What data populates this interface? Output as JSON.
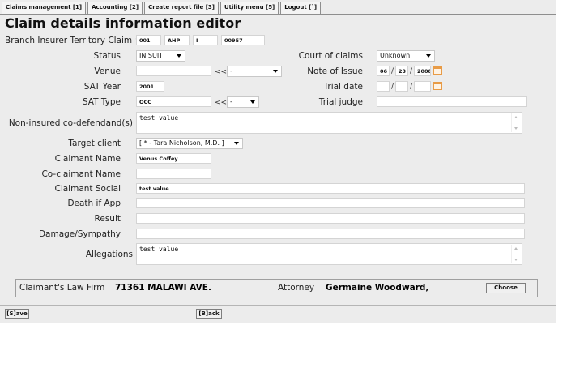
{
  "tabs": [
    "Claims management [1]",
    "Accounting [2]",
    "Create report file [3]",
    "Utility menu [5]",
    "Logout [`]"
  ],
  "page_title": "Claim details information editor",
  "claim_number": {
    "label": "Branch Insurer Territory Claim #",
    "branch": "001",
    "insurer": "AHP",
    "territory": "I",
    "claim": "00957"
  },
  "status": {
    "label": "Status",
    "value": "IN SUIT"
  },
  "court_of_claims": {
    "label": "Court of claims",
    "value": "Unknown"
  },
  "venue": {
    "label": "Venue",
    "value": "",
    "sep": "<<",
    "select": "-"
  },
  "note_of_issue": {
    "label": "Note of Issue",
    "month": "06",
    "day": "23",
    "year": "2008",
    "sep": "/"
  },
  "sat_year": {
    "label": "SAT Year",
    "value": "2001"
  },
  "trial_date": {
    "label": "Trial date",
    "month": "",
    "day": "",
    "year": "",
    "sep": "/"
  },
  "sat_type": {
    "label": "SAT Type",
    "value": "OCC",
    "sep": "<<",
    "select": "-"
  },
  "trial_judge": {
    "label": "Trial judge",
    "value": ""
  },
  "non_insured": {
    "label": "Non-insured co-defendand(s)",
    "value": "test value"
  },
  "target_client": {
    "label": "Target client",
    "value": "[ * - Tara Nicholson, M.D. ]"
  },
  "claimant_name": {
    "label": "Claimant Name",
    "value": "Venus Coffey"
  },
  "co_claimant_name": {
    "label": "Co-claimant Name",
    "value": ""
  },
  "claimant_social": {
    "label": "Claimant Social",
    "value": "test value"
  },
  "death_if_app": {
    "label": "Death if App",
    "value": ""
  },
  "result": {
    "label": "Result",
    "value": ""
  },
  "damage_sympathy": {
    "label": "Damage/Sympathy",
    "value": ""
  },
  "allegations": {
    "label": "Allegations",
    "value": "test value"
  },
  "law_firm": {
    "label": "Claimant's Law Firm",
    "value": "71361 MALAWI AVE.",
    "attorney_label": "Attorney",
    "attorney": "Germaine Woodward,",
    "choose": "Choose"
  },
  "save_label": "[S]ave",
  "back_label": "[B]ack"
}
